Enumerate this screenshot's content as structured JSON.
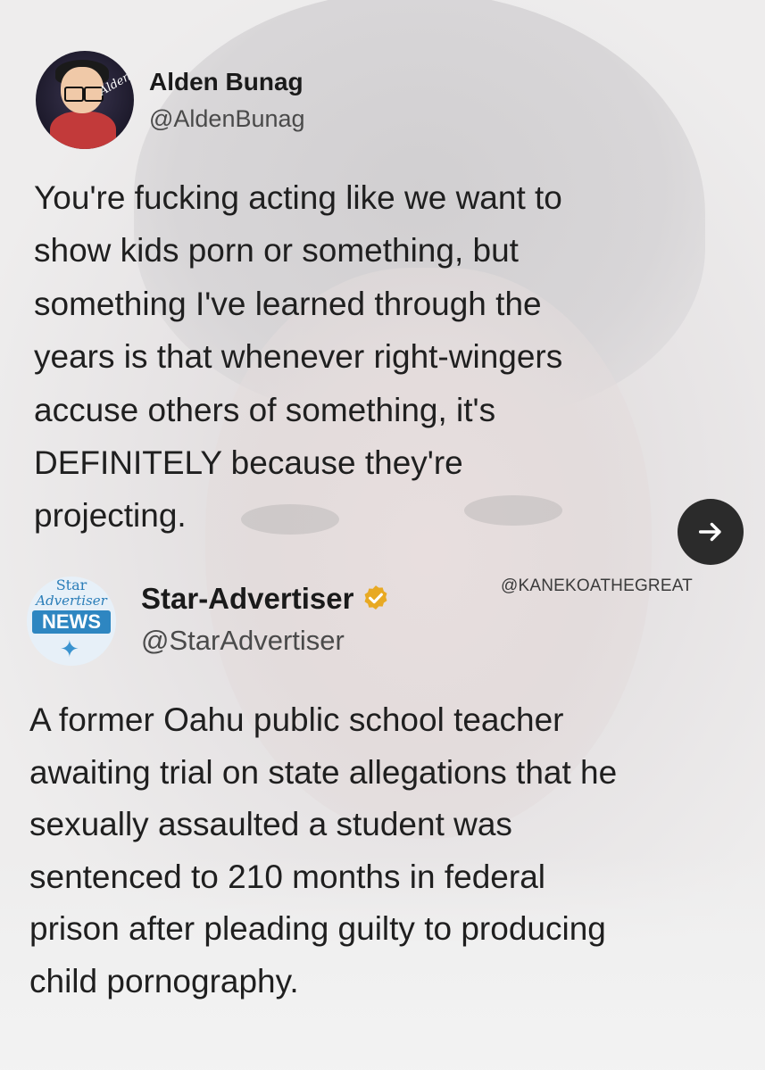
{
  "tweet1": {
    "name": "Alden Bunag",
    "handle": "@AldenBunag",
    "avatar_signature": "Alden",
    "text": "You're fucking acting like we want to\nshow kids porn or something, but\nsomething I've learned through the\nyears is that whenever right-wingers\naccuse others of something, it's\nDEFINITELY because they're\nprojecting."
  },
  "next_button": {
    "icon": "arrow-right-icon"
  },
  "watermark": "@KANEKOATHEGREAT",
  "tweet2": {
    "name": "Star-Advertiser",
    "verified_icon": "verified-badge-icon",
    "verified_color": "#E8A923",
    "handle": "@StarAdvertiser",
    "avatar": {
      "line1": "Star",
      "line2": "Advertiser",
      "badge": "NEWS"
    },
    "text": "A former Oahu public school teacher\nawaiting trial on state allegations that he\nsexually assaulted a student was\nsentenced to 210 months in federal\nprison after pleading guilty to producing\nchild pornography."
  }
}
